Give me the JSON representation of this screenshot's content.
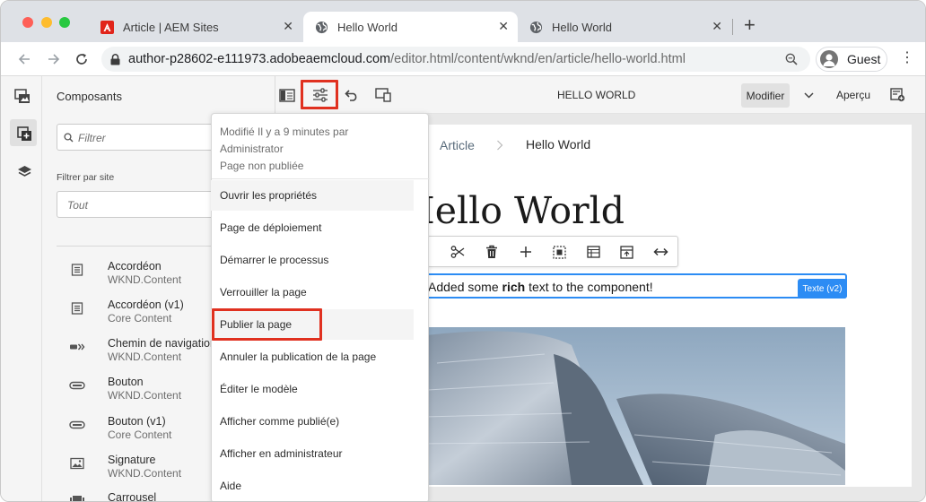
{
  "browser": {
    "tabs": [
      {
        "label": "Article | AEM Sites",
        "icon": "adobe-icon",
        "active": false
      },
      {
        "label": "Hello World",
        "icon": "globe-icon",
        "active": true
      },
      {
        "label": "Hello World",
        "icon": "globe-icon",
        "active": false
      }
    ],
    "new_tab": "+",
    "url_host": "author-p28602-e111973.adobeaemcloud.com",
    "url_path": "/editor.html/content/wknd/en/article/hello-world.html",
    "profile_label": "Guest",
    "colors": {
      "close_dot": "#fe5f57",
      "min_dot": "#febc2e",
      "max_dot": "#28c840",
      "highlight": "#e03120",
      "accent": "#2c8cf4"
    }
  },
  "side_panel": {
    "title": "Composants",
    "filter_placeholder": "Filtrer",
    "site_filter_label": "Filtrer par site",
    "site_filter_value": "Tout",
    "components": [
      {
        "name": "Accordéon",
        "group": "WKND.Content",
        "icon": "list-icon"
      },
      {
        "name": "Accordéon (v1)",
        "group": "Core Content",
        "icon": "list-icon"
      },
      {
        "name": "Chemin de navigation",
        "group": "WKND.Content",
        "icon": "breadcrumb-icon"
      },
      {
        "name": "Bouton",
        "group": "WKND.Content",
        "icon": "button-icon"
      },
      {
        "name": "Bouton (v1)",
        "group": "Core Content",
        "icon": "button-icon"
      },
      {
        "name": "Signature",
        "group": "WKND.Content",
        "icon": "image-icon"
      },
      {
        "name": "Carrousel",
        "group": "",
        "icon": "carousel-icon"
      }
    ]
  },
  "toolbar": {
    "page_title": "HELLO WORLD",
    "edit_mode": "Modifier",
    "preview": "Aperçu"
  },
  "page_info": {
    "meta_line1": "Modifié Il y a 9 minutes par",
    "meta_line2": "Administrator",
    "meta_line3": "Page non publiée",
    "items": [
      "Ouvrir les propriétés",
      "Page de déploiement",
      "Démarrer le processus",
      "Verrouiller la page",
      "Publier la page",
      "Annuler la publication de la page",
      "Éditer le modèle",
      "Afficher comme publié(e)",
      "Afficher en administrateur",
      "Aide"
    ]
  },
  "page": {
    "breadcrumb_parent": "Article",
    "breadcrumb_current": "Hello World",
    "heading": "Hello World",
    "text_before": "Added some ",
    "text_bold": "rich",
    "text_after": " text to the component!",
    "component_badge": "Texte (v2)"
  }
}
